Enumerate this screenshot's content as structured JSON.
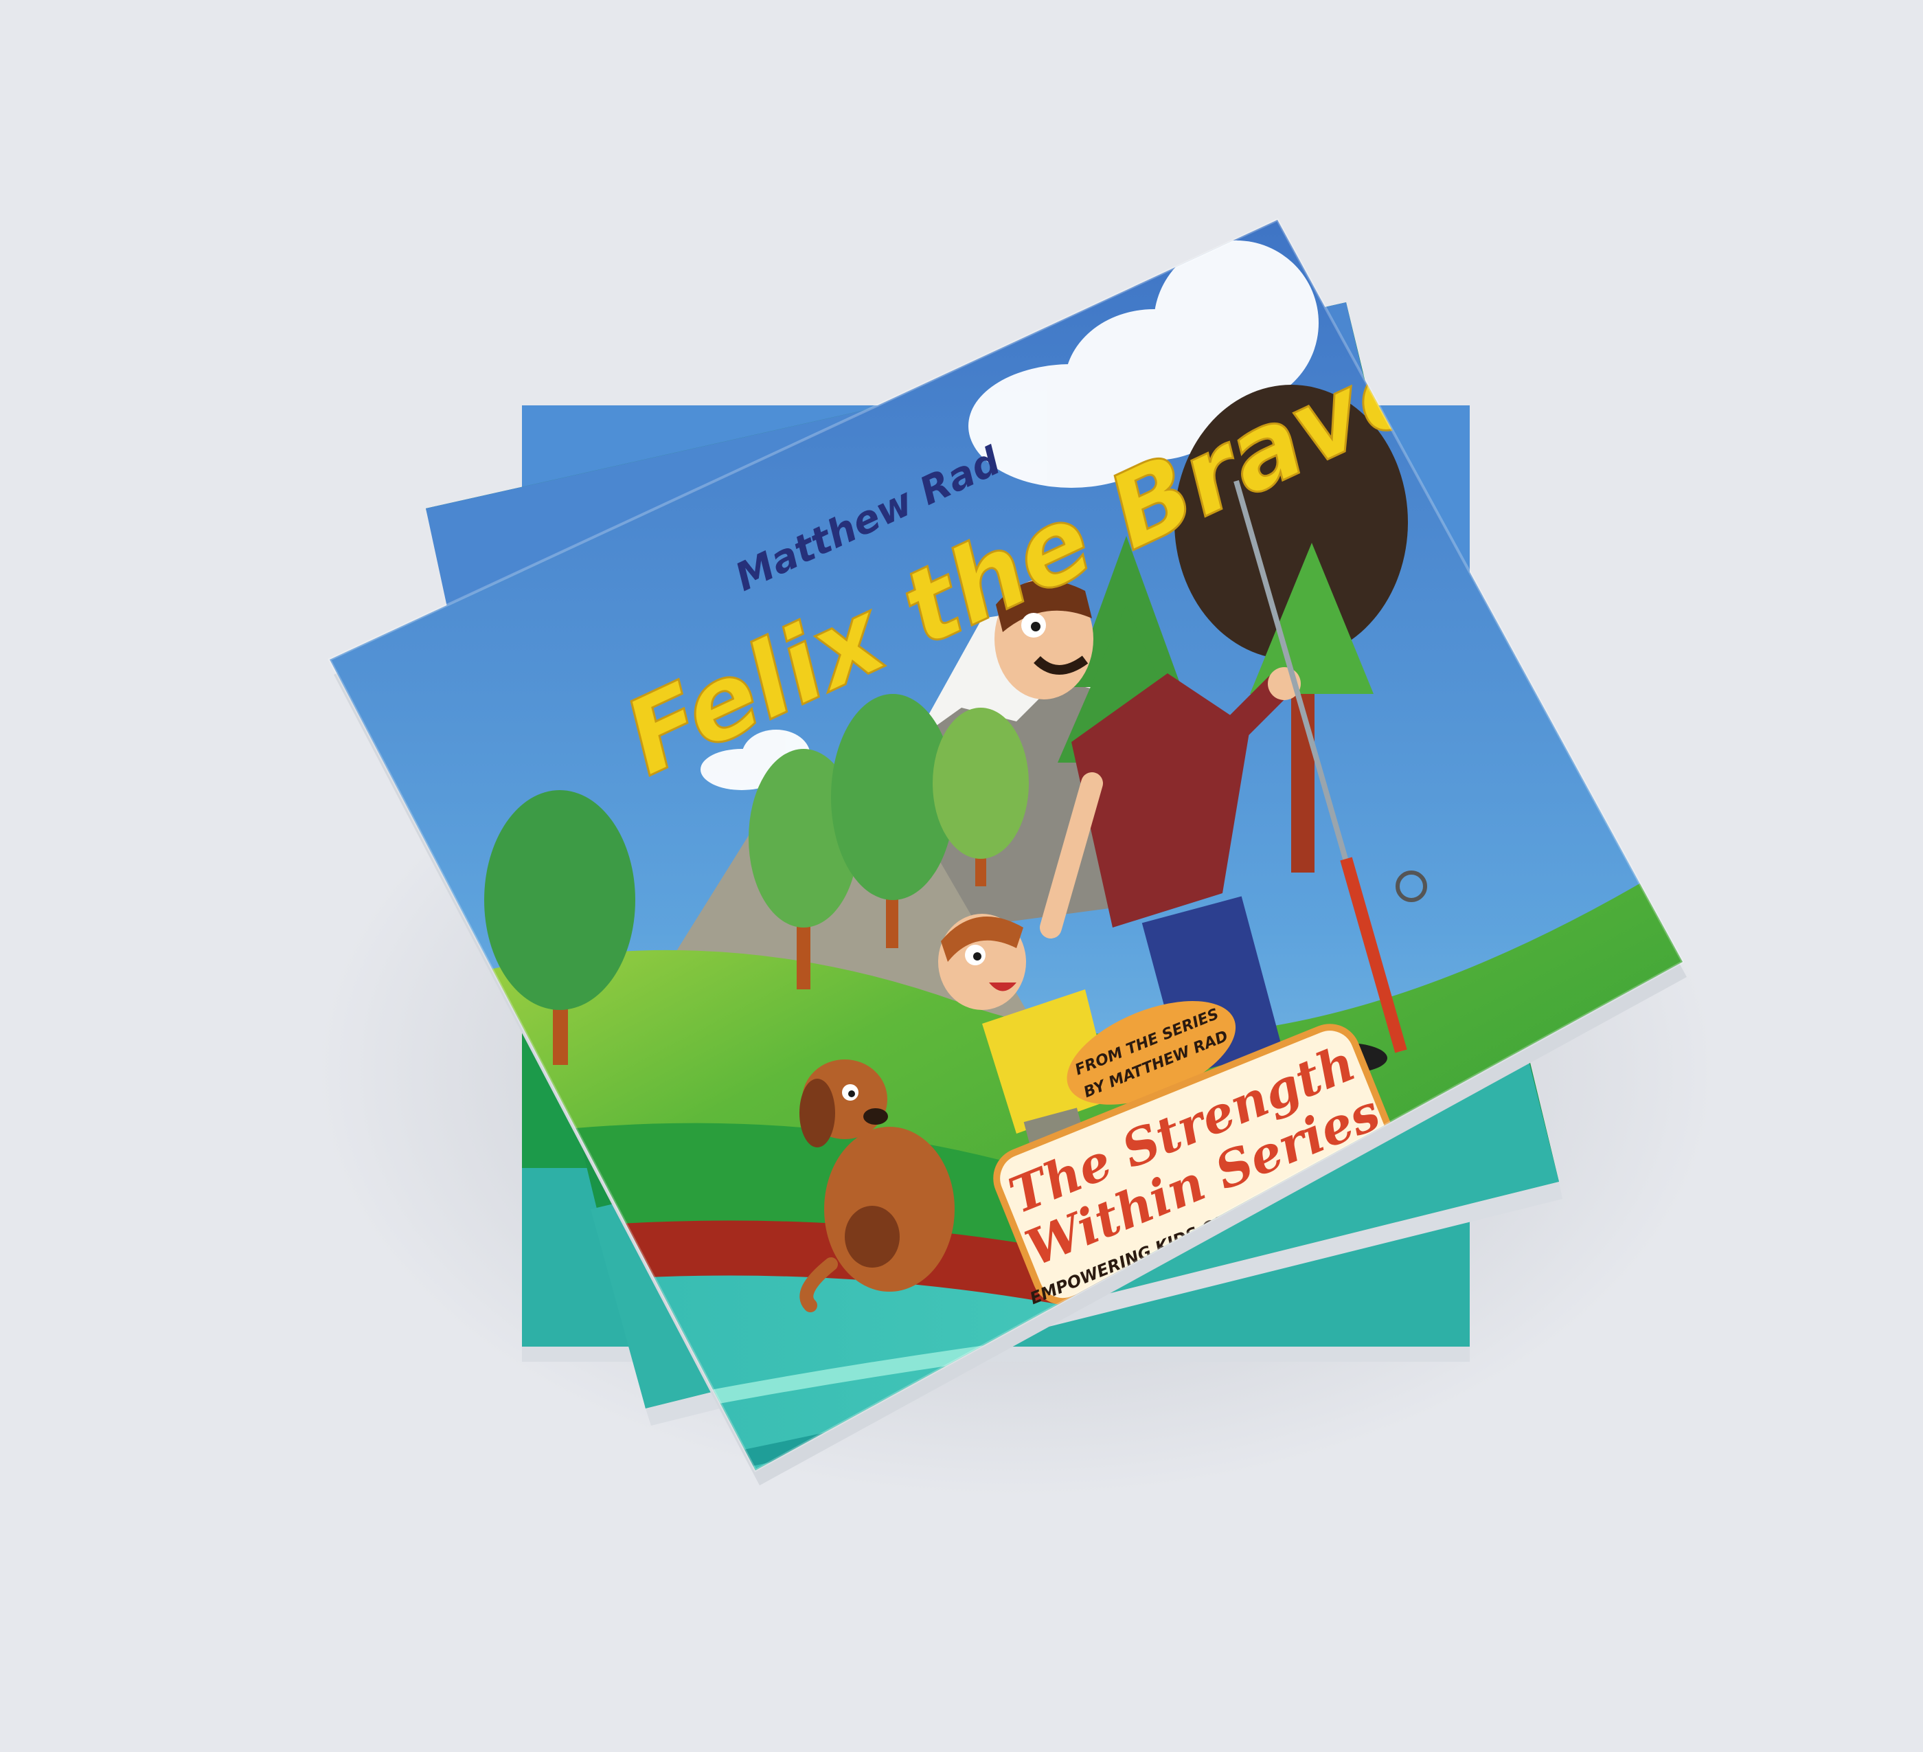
{
  "scene": {
    "background_color": "#e6e8ed",
    "description_colors": {
      "sky_top": "#3f73c4",
      "sky_bottom": "#8fd0ea",
      "grass": "#2fa33d",
      "grass_dark": "#157f3a",
      "river": "#3fc6b8",
      "river_dark": "#1f9e98",
      "bank": "#a52a1d",
      "title_yellow": "#f2cf1b",
      "author_blue": "#26307a",
      "series_red": "#d8452a",
      "badge_orange": "#f0a23a"
    }
  },
  "book": {
    "author": "Matthew Rad",
    "title": "Felix the Brave",
    "series_badge": {
      "line1": "FROM THE SERIES",
      "line2": "BY MATTHEW RAD"
    },
    "series_title": {
      "line1": "The Strength",
      "line2": "Within Series"
    },
    "tagline": "EMPOWERING KIDS ON THEIR LIFE JOURNEY"
  }
}
